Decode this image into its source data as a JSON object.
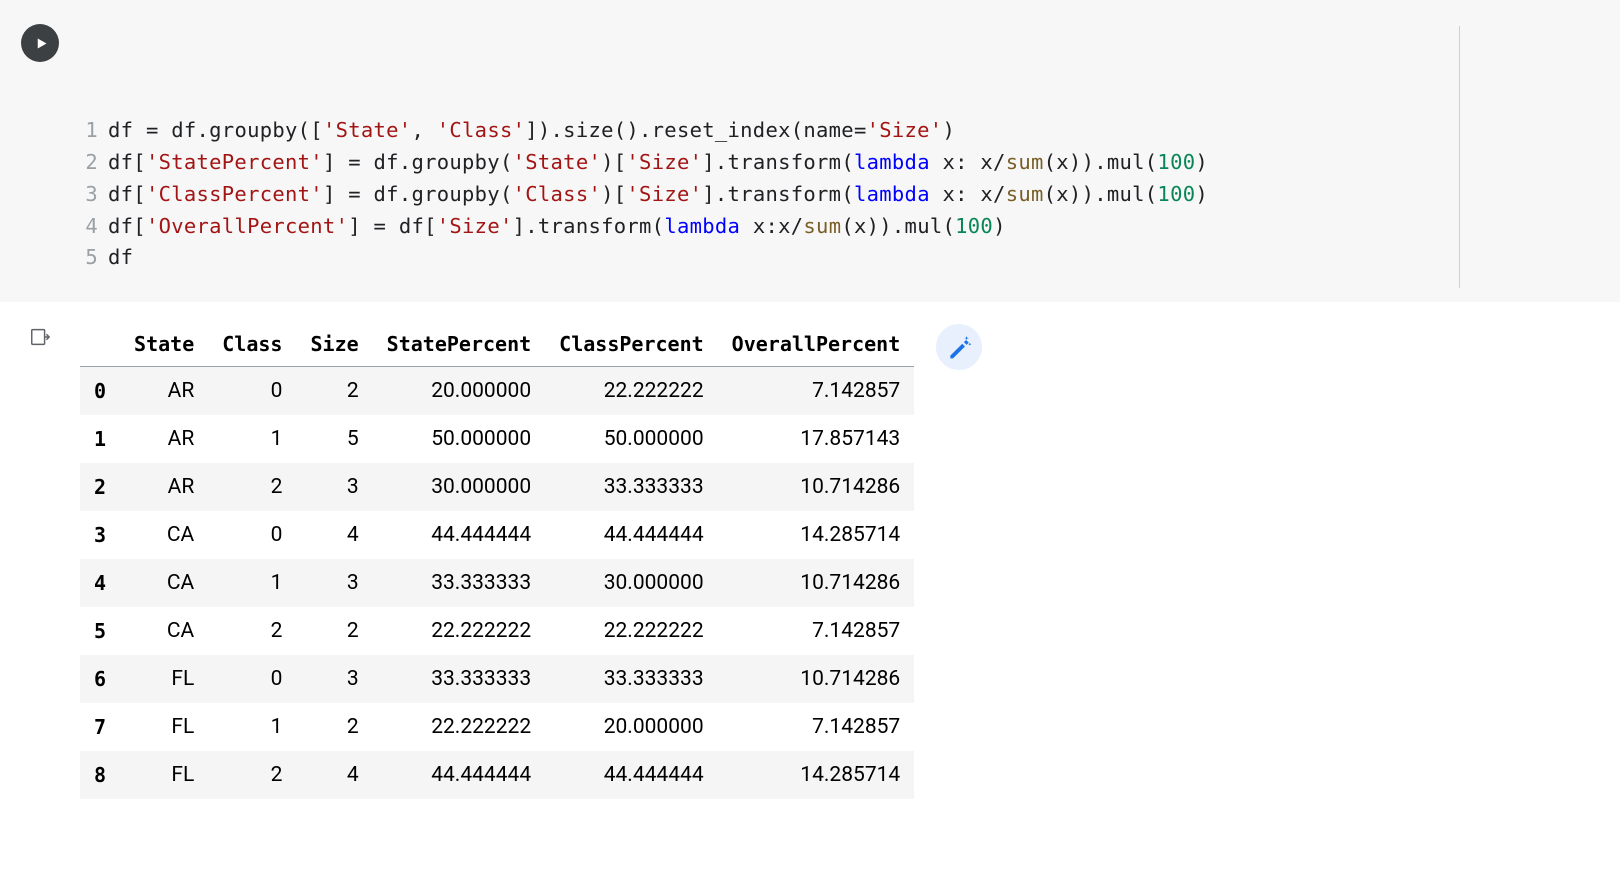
{
  "code": {
    "lines": [
      {
        "n": "1",
        "html": "df <span class='tok-punct'>=</span> df.groupby([<span class='tok-str'>'State'</span>, <span class='tok-str'>'Class'</span>]).size().reset_index(name=<span class='tok-str'>'Size'</span>)"
      },
      {
        "n": "2",
        "html": "df[<span class='tok-str'>'StatePercent'</span>] <span class='tok-punct'>=</span> df.groupby(<span class='tok-str'>'State'</span>)[<span class='tok-str'>'Size'</span>].transform(<span class='tok-kw'>lambda</span> x: x/<span class='tok-builtin'>sum</span>(x)).mul(<span class='tok-num'>100</span>)"
      },
      {
        "n": "3",
        "html": "df[<span class='tok-str'>'ClassPercent'</span>] <span class='tok-punct'>=</span> df.groupby(<span class='tok-str'>'Class'</span>)[<span class='tok-str'>'Size'</span>].transform(<span class='tok-kw'>lambda</span> x: x/<span class='tok-builtin'>sum</span>(x)).mul(<span class='tok-num'>100</span>)"
      },
      {
        "n": "4",
        "html": "df[<span class='tok-str'>'OverallPercent'</span>] <span class='tok-punct'>=</span> df[<span class='tok-str'>'Size'</span>].transform(<span class='tok-kw'>lambda</span> x:x/<span class='tok-builtin'>sum</span>(x)).mul(<span class='tok-num'>100</span>)"
      },
      {
        "n": "5",
        "html": "df"
      }
    ]
  },
  "table": {
    "columns": [
      "",
      "State",
      "Class",
      "Size",
      "StatePercent",
      "ClassPercent",
      "OverallPercent"
    ],
    "rows": [
      {
        "idx": "0",
        "cells": [
          "AR",
          "0",
          "2",
          "20.000000",
          "22.222222",
          "7.142857"
        ]
      },
      {
        "idx": "1",
        "cells": [
          "AR",
          "1",
          "5",
          "50.000000",
          "50.000000",
          "17.857143"
        ]
      },
      {
        "idx": "2",
        "cells": [
          "AR",
          "2",
          "3",
          "30.000000",
          "33.333333",
          "10.714286"
        ]
      },
      {
        "idx": "3",
        "cells": [
          "CA",
          "0",
          "4",
          "44.444444",
          "44.444444",
          "14.285714"
        ]
      },
      {
        "idx": "4",
        "cells": [
          "CA",
          "1",
          "3",
          "33.333333",
          "30.000000",
          "10.714286"
        ]
      },
      {
        "idx": "5",
        "cells": [
          "CA",
          "2",
          "2",
          "22.222222",
          "22.222222",
          "7.142857"
        ]
      },
      {
        "idx": "6",
        "cells": [
          "FL",
          "0",
          "3",
          "33.333333",
          "33.333333",
          "10.714286"
        ]
      },
      {
        "idx": "7",
        "cells": [
          "FL",
          "1",
          "2",
          "22.222222",
          "20.000000",
          "7.142857"
        ]
      },
      {
        "idx": "8",
        "cells": [
          "FL",
          "2",
          "4",
          "44.444444",
          "44.444444",
          "14.285714"
        ]
      }
    ]
  }
}
